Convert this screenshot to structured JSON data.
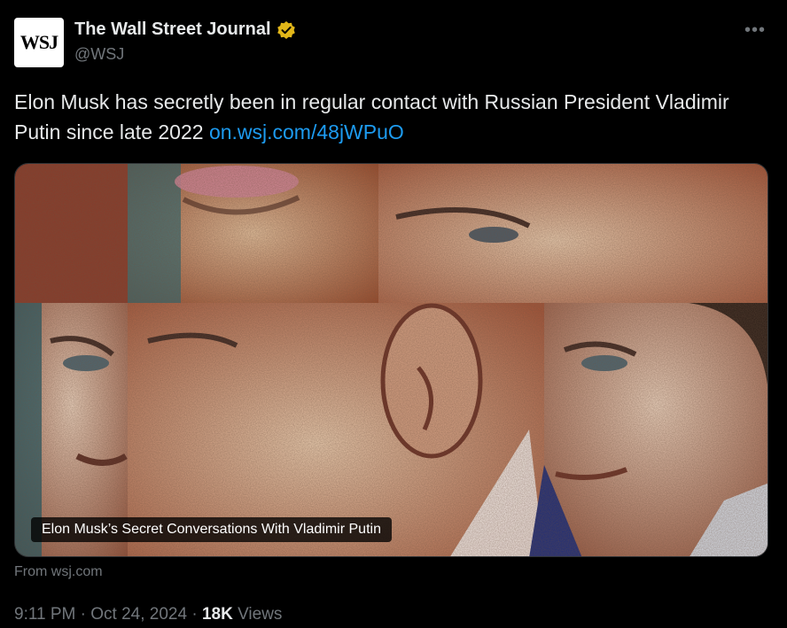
{
  "author": {
    "avatar_text": "WSJ",
    "display_name": "The Wall Street Journal",
    "handle": "@WSJ",
    "verified_icon": "verified-gold-badge-icon"
  },
  "more_icon": "more-horizontal-icon",
  "more_glyph": "•••",
  "tweet": {
    "text": "Elon Musk has secretly been in regular contact with Russian President Vladimir Putin since late 2022",
    "link": "on.wsj.com/48jWPuO"
  },
  "card": {
    "caption": "Elon Musk’s Secret Conversations With Vladimir Putin",
    "source": "From wsj.com"
  },
  "meta": {
    "time": "9:11 PM",
    "separator": "·",
    "date": "Oct 24, 2024",
    "views_count": "18K",
    "views_label": "Views"
  },
  "colors": {
    "background": "#000000",
    "text": "#e7e9ea",
    "muted": "#71767b",
    "link": "#1d9bf0",
    "verified": "#e2b719"
  }
}
